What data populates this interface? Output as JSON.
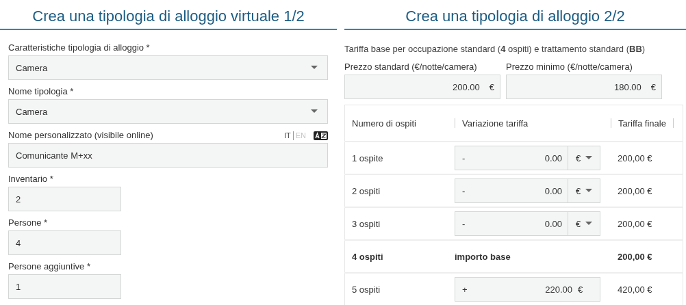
{
  "left": {
    "title": "Crea una tipologia di alloggio virtuale 1/2",
    "fields": [
      {
        "kind": "select",
        "label": "Caratteristiche tipologia di alloggio *",
        "value": "Camera"
      },
      {
        "kind": "select",
        "label": "Nome tipologia *",
        "value": "Camera"
      },
      {
        "kind": "text",
        "label": "Nome personalizzato (visibile online)",
        "value": "Comunicante M+xx",
        "languages": [
          {
            "label": "IT",
            "selected": true
          },
          {
            "label": "EN",
            "selected": false
          }
        ]
      },
      {
        "kind": "short",
        "label": "Inventario *",
        "value": "2"
      },
      {
        "kind": "short",
        "label": "Persone *",
        "value": "4"
      },
      {
        "kind": "short",
        "label": "Persone aggiuntive *",
        "value": "1"
      }
    ]
  },
  "right": {
    "title": "Crea una tipologia di alloggio 2/2",
    "note": "Tariffa base per occupazione standard (**4** ospiti) e trattamento standard (**BB**)",
    "prices": [
      {
        "label": "Prezzo standard (€/notte/camera)",
        "value": "200.00",
        "unit": "€"
      },
      {
        "label": "Prezzo minimo (€/notte/camera)",
        "value": "180.00",
        "unit": "€"
      }
    ],
    "table": {
      "columns": [
        "Numero di ospiti",
        "Variazione tariffa",
        "Tariffa finale"
      ],
      "rows": [
        {
          "kind": "adjust",
          "guests": "1 ospite",
          "sign": "-",
          "value": "0.00",
          "unit": "€",
          "final": "200,00 €"
        },
        {
          "kind": "adjust",
          "guests": "2 ospiti",
          "sign": "-",
          "value": "0.00",
          "unit": "€",
          "final": "200,00 €"
        },
        {
          "kind": "adjust",
          "guests": "3 ospiti",
          "sign": "-",
          "value": "0.00",
          "unit": "€",
          "final": "200,00 €"
        },
        {
          "kind": "base",
          "guests": "4 ospiti",
          "note": "importo base",
          "final": "200,00 €"
        },
        {
          "kind": "fixed",
          "guests": "5 ospiti",
          "sign": "+",
          "value": "220.00",
          "unit": "€",
          "final": "420,00 €"
        }
      ]
    }
  }
}
